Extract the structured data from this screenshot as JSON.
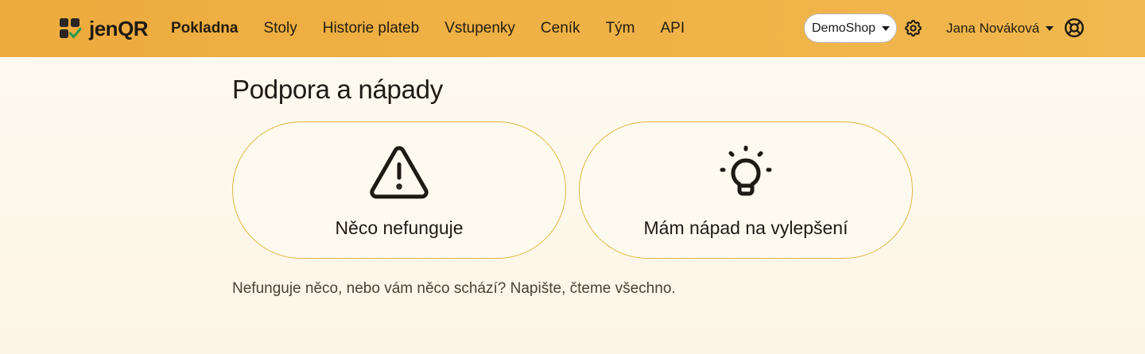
{
  "brand": {
    "name": "jenQR"
  },
  "nav": {
    "items": [
      {
        "label": "Pokladna",
        "active": true
      },
      {
        "label": "Stoly",
        "active": false
      },
      {
        "label": "Historie plateb",
        "active": false
      },
      {
        "label": "Vstupenky",
        "active": false
      },
      {
        "label": "Ceník",
        "active": false
      },
      {
        "label": "Tým",
        "active": false
      },
      {
        "label": "API",
        "active": false
      }
    ]
  },
  "header": {
    "shop_selector": {
      "value": "DemoShop",
      "icon": "caret-down-icon"
    },
    "settings_icon": "gear-icon",
    "user": {
      "name": "Jana Nováková",
      "icon": "caret-down-icon"
    },
    "help_icon": "lifebuoy-icon"
  },
  "main": {
    "title": "Podpora a nápady",
    "cards": [
      {
        "label": "Něco nefunguje",
        "icon": "warning-triangle-icon"
      },
      {
        "label": "Mám nápad na vylepšení",
        "icon": "lightbulb-icon"
      }
    ],
    "note": "Nefunguje něco, nebo vám něco schází? Napište, čteme všechno."
  },
  "colors": {
    "navbar": "#eeab3e",
    "card_border": "#e0b740",
    "logo_check": "#2e9a4a",
    "text": "#1e1a14"
  }
}
